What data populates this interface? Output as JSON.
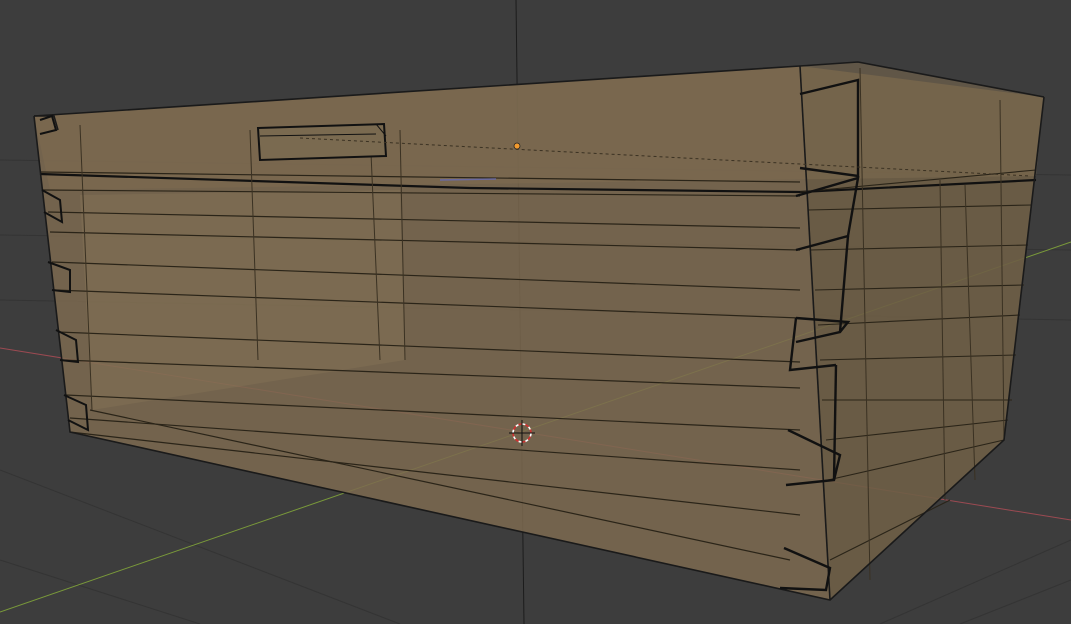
{
  "viewport": {
    "background_color": "#3d3d3d",
    "shading": "x-ray"
  },
  "object": {
    "type": "dovetailed wooden box",
    "material_color": "#8c785a",
    "edge_color": "#1a1a1a"
  },
  "overlays": {
    "grid_color": "#2f2f2f",
    "x_axis_color": "#9c4a52",
    "y_axis_color": "#7a9a3a",
    "z_axis_color": "#1c1c1c",
    "origin_color": "#f29a2e",
    "cursor_color": "#ffffff",
    "cursor_accent_color": "#d03030"
  }
}
